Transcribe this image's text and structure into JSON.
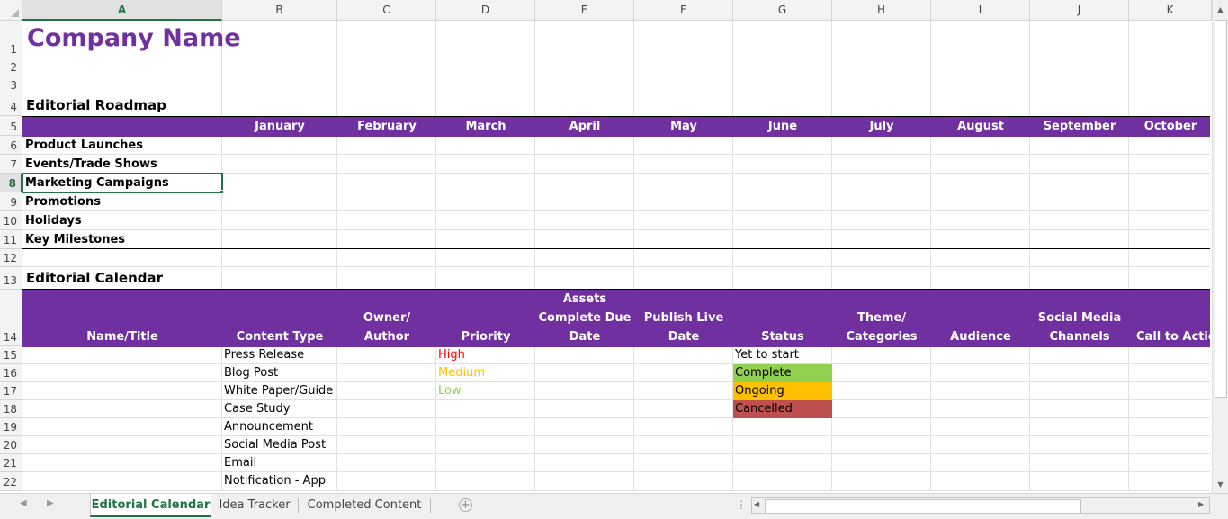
{
  "columns": [
    "A",
    "B",
    "C",
    "D",
    "E",
    "F",
    "G",
    "H",
    "I",
    "J",
    "K"
  ],
  "rows": [
    "1",
    "2",
    "3",
    "4",
    "5",
    "6",
    "7",
    "8",
    "9",
    "10",
    "11",
    "12",
    "13",
    "14",
    "15",
    "16",
    "17",
    "18",
    "19",
    "20",
    "21",
    "22"
  ],
  "cells": {
    "company_name": "Company Name",
    "roadmap_title": "Editorial Roadmap",
    "calendar_title": "Editorial Calendar",
    "months": [
      "January",
      "February",
      "March",
      "April",
      "May",
      "June",
      "July",
      "August",
      "September",
      "October"
    ],
    "roadmap_rows": [
      "Product Launches",
      "Events/Trade Shows",
      "Marketing Campaigns",
      "Promotions",
      "Holidays",
      "Key Milestones"
    ],
    "calendar_headers": {
      "name": "Name/Title",
      "content_type": "Content Type",
      "owner_1": "Owner/",
      "owner_2": "Author",
      "priority": "Priority",
      "assets_1": "Assets",
      "assets_2": "Complete Due",
      "assets_3": "Date",
      "publish_1": "Publish Live",
      "publish_2": "Date",
      "status": "Status",
      "theme_1": "Theme/",
      "theme_2": "Categories",
      "audience": "Audience",
      "social_1": "Social Media",
      "social_2": "Channels",
      "cta": "Call to Actio"
    },
    "content_types": [
      "Press Release",
      "Blog Post",
      "White Paper/Guide",
      "Case Study",
      "Announcement",
      "Social Media Post",
      "Email",
      "Notification - App"
    ],
    "priorities": [
      "High",
      "Medium",
      "Low"
    ],
    "statuses": [
      "Yet to start",
      "Complete",
      "Ongoing",
      "Cancelled"
    ]
  },
  "colors": {
    "purple": "#7030a0",
    "high": "#ff0000",
    "medium": "#ffc000",
    "low": "#92d050",
    "complete": "#92d050",
    "ongoing": "#ffc000",
    "cancelled": "#c0504d",
    "excel_green": "#217346"
  },
  "tabs": {
    "active": "Editorial Calendar",
    "idea": "Idea Tracker",
    "completed": "Completed Content"
  }
}
